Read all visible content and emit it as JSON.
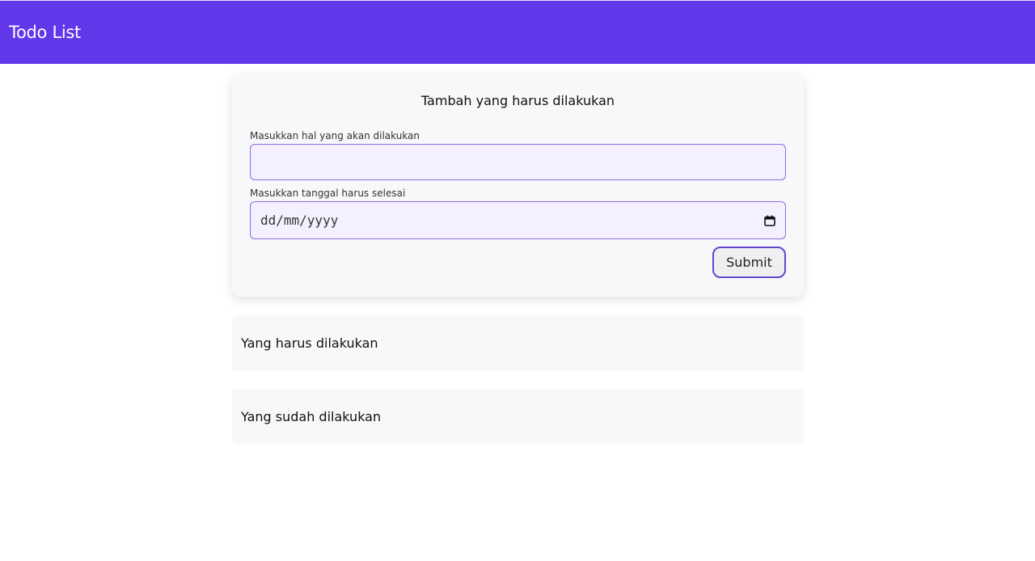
{
  "header": {
    "title": "Todo List",
    "background": "#6236e9"
  },
  "form": {
    "title": "Tambah yang harus dilakukan",
    "task_label": "Masukkan hal yang akan dilakukan",
    "task_value": "",
    "date_label": "Masukkan tanggal harus selesai",
    "date_placeholder": "dd/mm/yyyy",
    "date_icon": "calendar-icon",
    "submit_label": "Submit"
  },
  "sections": {
    "todo_title": "Yang harus dilakukan",
    "done_title": "Yang sudah dilakukan"
  },
  "colors": {
    "accent": "#6236e9",
    "input_border": "#8c6ee0",
    "input_background": "#f5f0ff",
    "card_background": "#f7f8fa"
  }
}
